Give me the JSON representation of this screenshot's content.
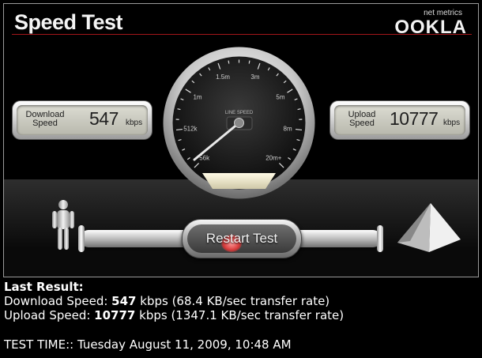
{
  "panel": {
    "title": "Speed Test",
    "logo": {
      "tagline": "net metrics",
      "wordmark": "OOKLA"
    }
  },
  "gauge": {
    "center_label": "LINE SPEED",
    "scale_labels": [
      "56k",
      "512k",
      "1m",
      "1.5m",
      "3m",
      "5m",
      "8m",
      "20m+"
    ],
    "needle_value": "547 kbps"
  },
  "download": {
    "label_line1": "Download",
    "label_line2": "Speed",
    "value": "547",
    "unit": "kbps"
  },
  "upload": {
    "label_line1": "Upload",
    "label_line2": "Speed",
    "value": "10777",
    "unit": "kbps"
  },
  "restart_button": {
    "label": "Restart Test"
  },
  "icons": {
    "person": "person-icon",
    "server": "pyramid-server-icon"
  },
  "results": {
    "heading": "Last Result:",
    "download_prefix": "Download Speed: ",
    "download_value": "547",
    "download_suffix": " kbps (68.4 KB/sec transfer rate)",
    "upload_prefix": "Upload Speed: ",
    "upload_value": "10777",
    "upload_suffix": " kbps (1347.1 KB/sec transfer rate)",
    "test_time": "TEST TIME:: Tuesday August 11, 2009, 10:48 AM"
  },
  "colors": {
    "background": "#000000",
    "title_rule": "#a4161a",
    "restart_glow": "#d63838"
  }
}
